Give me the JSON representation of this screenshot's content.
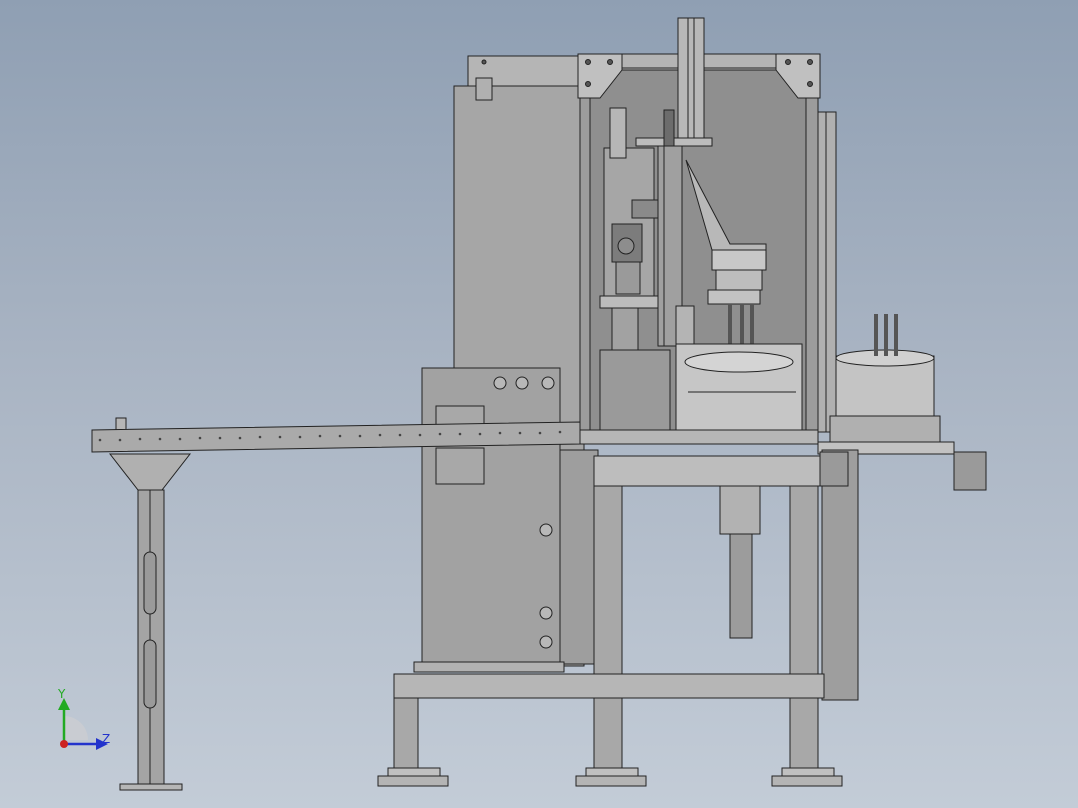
{
  "triad": {
    "y_label": "Y",
    "z_label": "Z",
    "y_color": "#22aa22",
    "z_color": "#2233cc",
    "x_color": "#cc2222"
  },
  "colors": {
    "metal": "#a3a3a3",
    "metal_light": "#c4c4c4",
    "metal_dark": "#8c8c8c",
    "edge": "#222222"
  }
}
